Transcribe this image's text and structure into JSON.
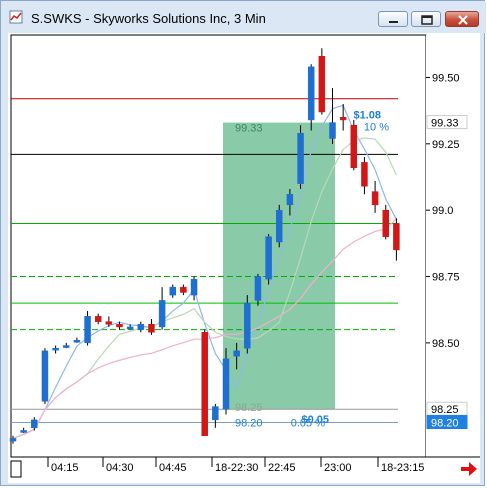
{
  "window": {
    "title": "S.SWKS - Skyworks Solutions Inc, 3 Min",
    "buttons": [
      "minimize",
      "maximize",
      "close"
    ]
  },
  "chart_data": {
    "type": "candlestick",
    "price_axis_ticks": [
      "99.50",
      "99.25",
      "99.0",
      "98.75",
      "98.50"
    ],
    "ylim": [
      98.07,
      99.66
    ],
    "time_axis_labels": [
      "04:15",
      "04:30",
      "04:45",
      "18-22:30",
      "22:45",
      "23:00",
      "18-23:15"
    ],
    "candles": [
      {
        "o": 98.13,
        "h": 98.15,
        "l": 98.12,
        "c": 98.14
      },
      {
        "o": 98.17,
        "h": 98.18,
        "l": 98.16,
        "c": 98.17
      },
      {
        "o": 98.18,
        "h": 98.22,
        "l": 98.17,
        "c": 98.21
      },
      {
        "o": 98.28,
        "h": 98.48,
        "l": 98.27,
        "c": 98.47
      },
      {
        "o": 98.48,
        "h": 98.49,
        "l": 98.46,
        "c": 98.48
      },
      {
        "o": 98.49,
        "h": 98.5,
        "l": 98.48,
        "c": 98.49
      },
      {
        "o": 98.51,
        "h": 98.52,
        "l": 98.5,
        "c": 98.51
      },
      {
        "o": 98.5,
        "h": 98.62,
        "l": 98.49,
        "c": 98.6
      },
      {
        "o": 98.6,
        "h": 98.61,
        "l": 98.57,
        "c": 98.58
      },
      {
        "o": 98.58,
        "h": 98.6,
        "l": 98.56,
        "c": 98.57
      },
      {
        "o": 98.57,
        "h": 98.58,
        "l": 98.55,
        "c": 98.56
      },
      {
        "o": 98.56,
        "h": 98.57,
        "l": 98.55,
        "c": 98.56
      },
      {
        "o": 98.55,
        "h": 98.58,
        "l": 98.54,
        "c": 98.57
      },
      {
        "o": 98.57,
        "h": 98.59,
        "l": 98.53,
        "c": 98.54
      },
      {
        "o": 98.56,
        "h": 98.71,
        "l": 98.55,
        "c": 98.66
      },
      {
        "o": 98.68,
        "h": 98.72,
        "l": 98.67,
        "c": 98.71
      },
      {
        "o": 98.71,
        "h": 98.72,
        "l": 98.68,
        "c": 98.69
      },
      {
        "o": 98.68,
        "h": 98.75,
        "l": 98.66,
        "c": 98.74
      },
      {
        "o": 98.54,
        "h": 98.55,
        "l": 98.15,
        "c": 98.15
      },
      {
        "o": 98.21,
        "h": 98.27,
        "l": 98.18,
        "c": 98.26
      },
      {
        "o": 98.25,
        "h": 98.48,
        "l": 98.23,
        "c": 98.44
      },
      {
        "o": 98.45,
        "h": 98.5,
        "l": 98.4,
        "c": 98.47
      },
      {
        "o": 98.48,
        "h": 98.68,
        "l": 98.46,
        "c": 98.65
      },
      {
        "o": 98.66,
        "h": 98.76,
        "l": 98.64,
        "c": 98.75
      },
      {
        "o": 98.74,
        "h": 98.91,
        "l": 98.72,
        "c": 98.9
      },
      {
        "o": 98.88,
        "h": 99.02,
        "l": 98.86,
        "c": 99.0
      },
      {
        "o": 99.02,
        "h": 99.08,
        "l": 98.98,
        "c": 99.06
      },
      {
        "o": 99.1,
        "h": 99.32,
        "l": 99.08,
        "c": 99.29
      },
      {
        "o": 99.34,
        "h": 99.55,
        "l": 99.3,
        "c": 99.54
      },
      {
        "o": 99.58,
        "h": 99.61,
        "l": 99.36,
        "c": 99.37
      },
      {
        "o": 99.27,
        "h": 99.46,
        "l": 99.25,
        "c": 99.33
      },
      {
        "o": 99.35,
        "h": 99.4,
        "l": 99.3,
        "c": 99.34
      },
      {
        "o": 99.32,
        "h": 99.34,
        "l": 99.15,
        "c": 99.16
      },
      {
        "o": 99.18,
        "h": 99.2,
        "l": 99.06,
        "c": 99.09
      },
      {
        "o": 99.07,
        "h": 99.11,
        "l": 98.99,
        "c": 99.02
      },
      {
        "o": 99.0,
        "h": 99.02,
        "l": 98.89,
        "c": 98.9
      },
      {
        "o": 98.95,
        "h": 98.97,
        "l": 98.81,
        "c": 98.85
      }
    ],
    "horizontal_levels": [
      {
        "value": 99.42,
        "color": "#c00000",
        "style": "solid"
      },
      {
        "value": 99.21,
        "color": "#000000",
        "style": "solid"
      },
      {
        "value": 98.95,
        "color": "#00b000",
        "style": "solid"
      },
      {
        "value": 98.75,
        "color": "#00b000",
        "style": "dashed"
      },
      {
        "value": 98.65,
        "color": "#00c000",
        "style": "solid"
      },
      {
        "value": 98.55,
        "color": "#00b000",
        "style": "dashed"
      },
      {
        "value": 98.25,
        "color": "#999999",
        "style": "solid"
      },
      {
        "value": 98.2,
        "color": "#7f9fbf",
        "style": "solid"
      }
    ],
    "measure_box": {
      "top_value": 99.33,
      "bottom_value": 98.25,
      "fill": "#3aa870",
      "labels": {
        "top_price": "99.33",
        "top_change": "$1.08",
        "top_pct": "10 %",
        "bottom_price": "98.25",
        "bottom_change": "$0.05",
        "low_price": "98.20",
        "low_pct": "0.05 %"
      }
    },
    "price_flags": [
      {
        "label": "99.33",
        "value": 99.33,
        "bg": "#ffffff",
        "fg": "#000000"
      },
      {
        "label": "98.25",
        "value": 98.25,
        "bg": "#ffffff",
        "fg": "#000000"
      },
      {
        "label": "98.20",
        "value": 98.2,
        "bg": "#2080e0",
        "fg": "#ffffff"
      }
    ],
    "colors": {
      "up": "#1f6fd0",
      "down": "#d01818",
      "ma_fast": "#8fb8e8",
      "ma_mid": "#b8d8b8",
      "ma_slow": "#f0b0c8"
    }
  }
}
